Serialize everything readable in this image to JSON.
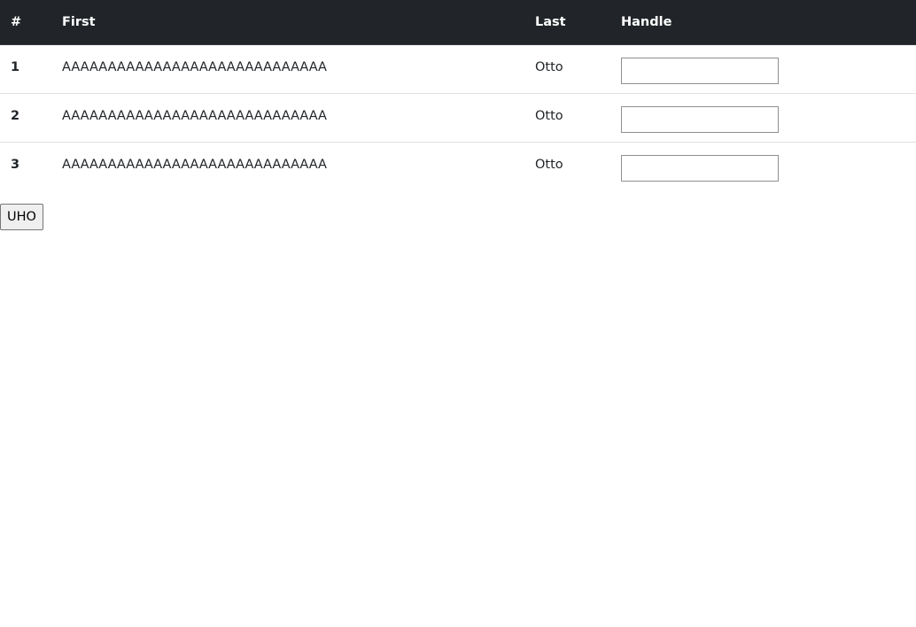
{
  "table": {
    "headers": {
      "num": "#",
      "first": "First",
      "last": "Last",
      "handle": "Handle"
    },
    "rows": [
      {
        "num": "1",
        "first": "AAAAAAAAAAAAAAAAAAAAAAAAAAAAA",
        "last": "Otto",
        "handle_value": ""
      },
      {
        "num": "2",
        "first": "AAAAAAAAAAAAAAAAAAAAAAAAAAAAA",
        "last": "Otto",
        "handle_value": ""
      },
      {
        "num": "3",
        "first": "AAAAAAAAAAAAAAAAAAAAAAAAAAAAA",
        "last": "Otto",
        "handle_value": ""
      }
    ]
  },
  "actions": {
    "submit_label": "UHO"
  },
  "colors": {
    "header_bg": "#212529",
    "header_text": "#ffffff",
    "row_border": "#dee2e6",
    "body_text": "#212529"
  }
}
